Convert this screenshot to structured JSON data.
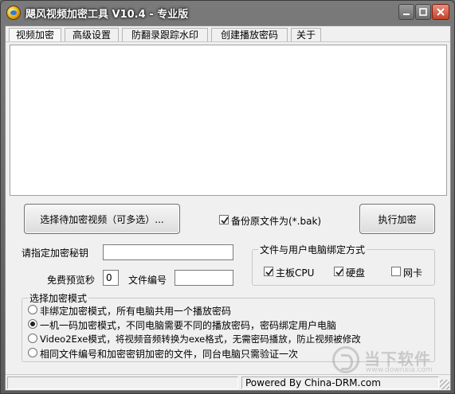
{
  "window": {
    "title": "飓风视频加密工具 V10.4 - 专业版",
    "icon": "app-logo-icon"
  },
  "menu": {
    "items": [
      {
        "label": "视频加密"
      },
      {
        "label": "高级设置"
      },
      {
        "label": "防翻录跟踪水印"
      },
      {
        "label": "创建播放密码"
      },
      {
        "label": "关于"
      }
    ]
  },
  "actions": {
    "select_videos_label": "选择待加密视频（可多选）...",
    "backup_label": "备份原文件为(*.bak)",
    "backup_checked": true,
    "execute_label": "执行加密"
  },
  "form": {
    "key_label": "请指定加密秘钥",
    "key_value": "",
    "preview_label": "免费预览秒",
    "preview_value": "0",
    "file_no_label": "文件编号",
    "file_no_value": ""
  },
  "binding": {
    "title": "文件与用户电脑绑定方式",
    "options": [
      {
        "label": "主板CPU",
        "checked": true
      },
      {
        "label": "硬盘",
        "checked": true
      },
      {
        "label": "网卡",
        "checked": false
      }
    ]
  },
  "mode": {
    "title": "选择加密模式",
    "options": [
      {
        "label": "非绑定加密模式，所有电脑共用一个播放密码",
        "selected": false
      },
      {
        "label": "一机一码加密模式，不同电脑需要不同的播放密码，密码绑定用户电脑",
        "selected": true
      },
      {
        "label": "Video2Exe模式，将视频音频转换为exe格式，无需密码播放，防止视频被修改",
        "selected": false
      },
      {
        "label": "相同文件编号和加密密钥加密的文件，同台电脑只需验证一次",
        "selected": false
      }
    ]
  },
  "status": {
    "powered_by": "Powered By China-DRM.com"
  },
  "watermark": {
    "text": "当下软件园",
    "url": "www.downxia.com"
  }
}
